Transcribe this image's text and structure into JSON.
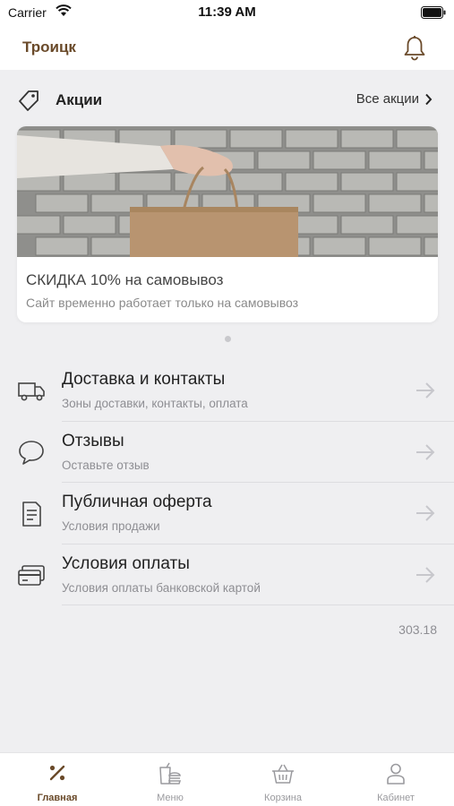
{
  "status_bar": {
    "carrier": "Carrier",
    "time": "11:39 AM"
  },
  "header": {
    "city": "Троицк"
  },
  "promos": {
    "title": "Акции",
    "all_link": "Все акции",
    "card": {
      "headline": "СКИДКА 10% на самовывоз",
      "subtitle": "Сайт временно работает только на самовывоз"
    }
  },
  "menu": [
    {
      "title": "Доставка и контакты",
      "subtitle": "Зоны доставки, контакты, оплата",
      "icon": "truck-icon"
    },
    {
      "title": "Отзывы",
      "subtitle": "Оставьте отзыв",
      "icon": "chat-bubble-icon"
    },
    {
      "title": "Публичная оферта",
      "subtitle": "Условия продажи",
      "icon": "document-icon"
    },
    {
      "title": "Условия оплаты",
      "subtitle": "Условия оплаты банковской картой",
      "icon": "credit-card-icon"
    }
  ],
  "version": "303.18",
  "tabs": [
    {
      "label": "Главная",
      "icon": "percent-icon",
      "active": true
    },
    {
      "label": "Меню",
      "icon": "food-menu-icon",
      "active": false
    },
    {
      "label": "Корзина",
      "icon": "basket-icon",
      "active": false
    },
    {
      "label": "Кабинет",
      "icon": "user-icon",
      "active": false
    }
  ],
  "colors": {
    "accent": "#6a4a2a",
    "background": "#efeff1",
    "inactive": "#9a9a9e"
  }
}
